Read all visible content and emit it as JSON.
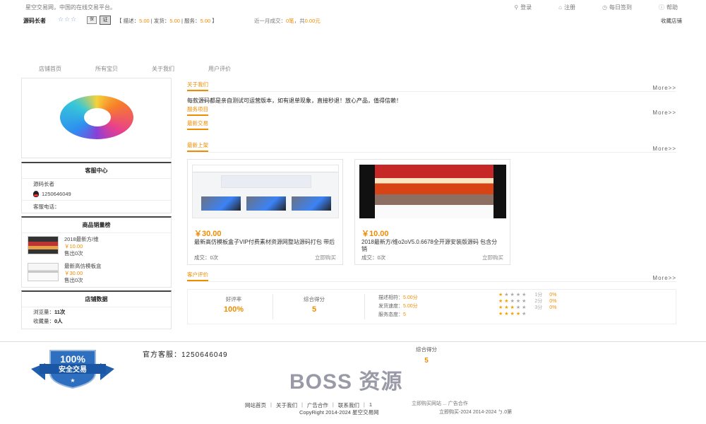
{
  "topbar": {
    "welcome": "星空交易网，中国的在线交易平台。",
    "links": [
      {
        "label": "登录",
        "icon": "user-icon"
      },
      {
        "label": "注册",
        "icon": "home-icon"
      },
      {
        "label": "每日签到",
        "icon": "calendar-icon"
      },
      {
        "label": "帮助",
        "icon": "help-icon"
      }
    ]
  },
  "shop": {
    "name": "源码长者",
    "stars": "☆☆☆",
    "badge1": "保",
    "badge2": "证",
    "ratings": {
      "desc_label": "【 描述：",
      "desc_value": "5.00",
      "ship_label": " | 发货：",
      "ship_value": "5.00",
      "svc_label": " | 服务：",
      "svc_value": "5.00",
      "end": " 】"
    },
    "recent_label": "近一月成交：",
    "recent_count": "0笔",
    "recent_sep": "，共",
    "recent_amount": "0.00元",
    "favorite": "收藏店铺"
  },
  "nav": [
    "店铺首页",
    "所有宝贝",
    "关于我们",
    "用户评价"
  ],
  "sidebar": {
    "service_title": "客服中心",
    "service_name": "源码长者",
    "service_qq": "1250646049",
    "service_phone": "客服电话：",
    "rank_title": "商品销量榜",
    "rank_items": [
      {
        "title": "2018最新方/维",
        "price": "￥10.00",
        "sold": "售出0次"
      },
      {
        "title": "最新高仿模板盒",
        "price": "￥30.00",
        "sold": "售出0次"
      }
    ],
    "stats_title": "店铺数据",
    "views_label": "浏览量：",
    "views_value": "11次",
    "favs_label": "收藏量：",
    "favs_value": "0人"
  },
  "main": {
    "about_title": "关于我们",
    "more": "More>>",
    "about_text": "每款源码都是亲自测试可运营版本，如有退单现象，直接秒退！放心产品，值得信赖！",
    "service_items": "服务项目",
    "latest_trade": "最新交易",
    "new_title": "最新上架",
    "products": [
      {
        "price": "￥30.00",
        "title": "最新高仿模板盒子VIP付费素材资源网整站源码打包 带后",
        "deals": "成交：0次",
        "buy": "立即购买"
      },
      {
        "price": "￥10.00",
        "title": "2018最新方/维o2oV5.0.6678全开源安装版源码 包含分销",
        "deals": "成交：0次",
        "buy": "立即购买"
      }
    ],
    "review_title": "客户评价",
    "good_label": "好评率",
    "good_value": "100%",
    "score_label": "综合得分",
    "score_value": "5",
    "lines": [
      {
        "label": "描述相符：",
        "value": "5.00分"
      },
      {
        "label": "发货速度：",
        "value": "5.00分"
      },
      {
        "label": "服务态度：",
        "value": "5"
      }
    ],
    "star_rows": [
      {
        "on": 1,
        "text": "1分",
        "pct": "0%"
      },
      {
        "on": 2,
        "text": "2分",
        "pct": "0%"
      },
      {
        "on": 3,
        "text": "3分",
        "pct": "0%"
      },
      {
        "on": 4,
        "text": "",
        "pct": ""
      }
    ]
  },
  "footer": {
    "badge_number": "100%",
    "badge_text": "安全交易",
    "kf": "官方客服：1250646049",
    "score_label": "综合得分",
    "score_value": "5",
    "watermark": "BOSS 资源",
    "links": [
      "网站首页",
      "关于我们",
      "广告合作",
      "联系我们",
      "1"
    ],
    "ghost_links": "立即购买网站 ... 广告合作",
    "copyright": "CopyRight 2014-2024 星空交易网",
    "copy_ghost": "立即购买-2024 2014-2024 ㄅ.0第"
  }
}
